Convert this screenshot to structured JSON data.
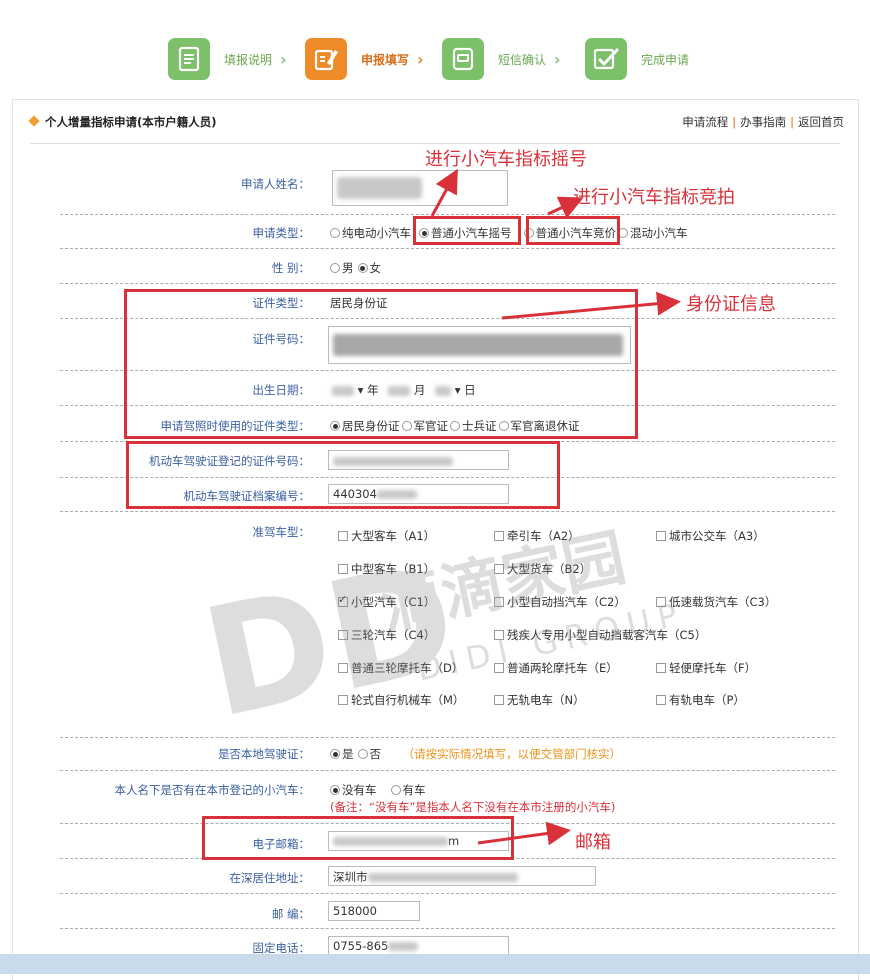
{
  "steps": [
    {
      "label": "填报说明",
      "active": false,
      "icon": "document-icon"
    },
    {
      "label": "申报填写",
      "active": true,
      "icon": "pencil-edit-icon"
    },
    {
      "label": "短信确认",
      "active": false,
      "icon": "message-icon"
    },
    {
      "label": "完成申请",
      "active": false,
      "icon": "checkmark-icon"
    }
  ],
  "header": {
    "title": "个人增量指标申请(本市户籍人员)",
    "links": [
      "申请流程",
      "办事指南",
      "返回首页"
    ]
  },
  "form": {
    "name_label": "申请人姓名：",
    "type_label": "申请类型：",
    "type_options": [
      "纯电动小汽车",
      "普通小汽车摇号",
      "普通小汽车竞价",
      "混动小汽车"
    ],
    "gender_label": "性    别：",
    "gender_options": [
      "男",
      "女"
    ],
    "idtype_label": "证件类型：",
    "idtype_value": "居民身份证",
    "idno_label": "证件号码：",
    "birth_label": "出生日期：",
    "birth_year": "年",
    "birth_month": "月",
    "birth_day": "日",
    "license_idtype_label": "申请驾照时使用的证件类型：",
    "license_idtype_options": [
      "居民身份证",
      "军官证",
      "士兵证",
      "军官离退休证"
    ],
    "license_idno_label": "机动车驾驶证登记的证件号码：",
    "license_file_label": "机动车驾驶证档案编号：",
    "license_file_value": "440304",
    "vehicle_label": "准驾车型：",
    "vehicle_types": [
      {
        "label": "大型客车（A1）",
        "checked": false
      },
      {
        "label": "牵引车（A2）",
        "checked": false
      },
      {
        "label": "城市公交车（A3）",
        "checked": false
      },
      {
        "label": "中型客车（B1）",
        "checked": false
      },
      {
        "label": "大型货车（B2）",
        "checked": false
      },
      {
        "label": "小型汽车（C1）",
        "checked": true
      },
      {
        "label": "小型自动挡汽车（C2）",
        "checked": false
      },
      {
        "label": "低速载货汽车（C3）",
        "checked": false
      },
      {
        "label": "三轮汽车（C4）",
        "checked": false
      },
      {
        "label": "残疾人专用小型自动挡载客汽车（C5）",
        "checked": false
      },
      {
        "label": "普通三轮摩托车（D）",
        "checked": false
      },
      {
        "label": "普通两轮摩托车（E）",
        "checked": false
      },
      {
        "label": "轻便摩托车（F）",
        "checked": false
      },
      {
        "label": "轮式自行机械车（M）",
        "checked": false
      },
      {
        "label": "无轨电车（N）",
        "checked": false
      },
      {
        "label": "有轨电车（P）",
        "checked": false
      }
    ],
    "local_license_label": "是否本地驾驶证：",
    "local_license_options": [
      "是",
      "否"
    ],
    "local_license_note": "（请按实际情况填写，以便交管部门核实）",
    "own_car_label": "本人名下是否有在本市登记的小汽车：",
    "own_car_options": [
      "没有车",
      "有车"
    ],
    "own_car_note": "(备注：“没有车”是指本人名下没有在本市注册的小汽车)",
    "email_label": "电子邮箱：",
    "email_suffix": "m",
    "address_label": "在深居住地址：",
    "address_value": "深圳市",
    "zip_label": "邮    编：",
    "zip_value": "518000",
    "phone_label": "固定电话：",
    "phone_value": "0755-865"
  },
  "annotations": {
    "lottery": "进行小汽车指标摇号",
    "bidding": "进行小汽车指标竞拍",
    "id_info": "身份证信息",
    "email": "邮箱"
  },
  "watermark": {
    "big": "DD",
    "cn": "滴滴家园",
    "en": "DIDI GROUP"
  },
  "colors": {
    "accent": "#d9313a",
    "label": "#3a5fa0",
    "step_green": "#7cc06a",
    "step_orange": "#ee8a28"
  }
}
